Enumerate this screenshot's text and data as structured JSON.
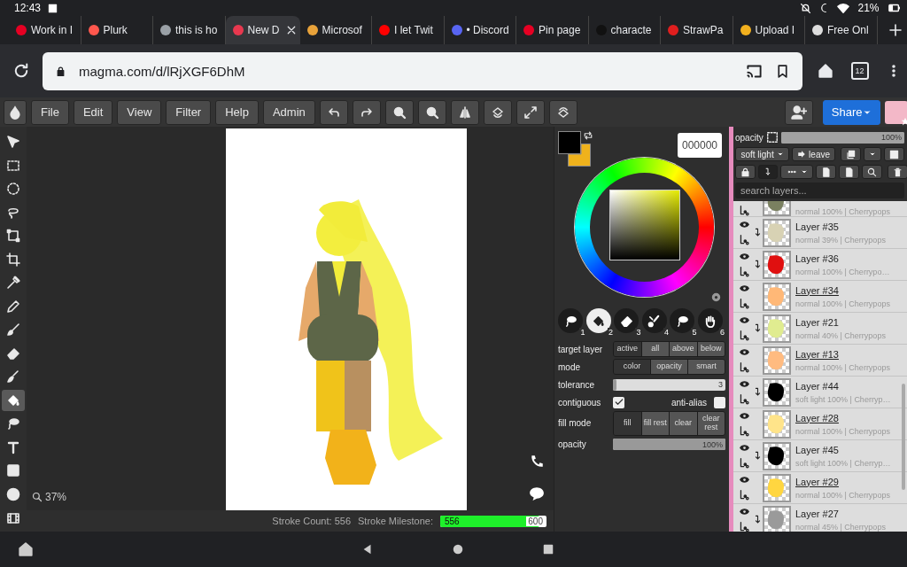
{
  "status_bar": {
    "time": "12:43",
    "battery": "21%"
  },
  "browser_tabs": [
    {
      "title": "Work in I",
      "color": "#e60023",
      "selected": false
    },
    {
      "title": "Plurk",
      "color": "#ff574d",
      "selected": false
    },
    {
      "title": "this is ho",
      "color": "#9aa0a6",
      "selected": false
    },
    {
      "title": "New D",
      "color": "#e8384f",
      "selected": true
    },
    {
      "title": "Microsof",
      "color": "#e8a23a",
      "selected": false
    },
    {
      "title": "I let Twit",
      "color": "#ff0000",
      "selected": false
    },
    {
      "title": "• Discord",
      "color": "#5865f2",
      "selected": false
    },
    {
      "title": "Pin page",
      "color": "#e60023",
      "selected": false
    },
    {
      "title": "characte",
      "color": "#111111",
      "selected": false
    },
    {
      "title": "StrawPa",
      "color": "#e01e1e",
      "selected": false
    },
    {
      "title": "Upload I",
      "color": "#f2b01e",
      "selected": false
    },
    {
      "title": "Free Onl",
      "color": "#dddddd",
      "selected": false
    }
  ],
  "address_bar": {
    "url": "magma.com/d/lRjXGF6DhM",
    "tab_count": "12"
  },
  "toolbar": {
    "menus": [
      "File",
      "Edit",
      "View",
      "Filter",
      "Help",
      "Admin"
    ],
    "share": "Share"
  },
  "tools": [
    {
      "kind": "move",
      "selected": false
    },
    {
      "kind": "rect-select",
      "selected": false
    },
    {
      "kind": "ellipse-select",
      "selected": false
    },
    {
      "kind": "lasso",
      "selected": false
    },
    {
      "kind": "transform",
      "selected": false
    },
    {
      "kind": "crop",
      "selected": false
    },
    {
      "kind": "eyedropper",
      "selected": false
    },
    {
      "kind": "pencil",
      "selected": false
    },
    {
      "kind": "brush",
      "selected": false
    },
    {
      "kind": "eraser",
      "selected": false
    },
    {
      "kind": "smudge",
      "selected": false
    },
    {
      "kind": "bucket",
      "selected": true
    },
    {
      "kind": "lasso-fill",
      "selected": false
    },
    {
      "kind": "text",
      "selected": false
    },
    {
      "kind": "rectangle",
      "selected": false
    },
    {
      "kind": "ellipse",
      "selected": false
    }
  ],
  "canvas": {
    "zoom": "37%"
  },
  "stroke_bar": {
    "count": "Stroke Count: 556",
    "milestone": "Stroke Milestone:",
    "progress": "556",
    "goal": "600",
    "level": 0.93
  },
  "swatches": [
    {
      "color": "#000000"
    },
    {
      "color": "#efb21c"
    }
  ],
  "hex": "000000",
  "fill_tools": [
    {
      "kind": "lasso-fill",
      "number": "1",
      "selected": false
    },
    {
      "kind": "bucket",
      "number": "2",
      "selected": true
    },
    {
      "kind": "eraser",
      "number": "3",
      "selected": false
    },
    {
      "kind": "brushes",
      "number": "4",
      "selected": false
    },
    {
      "kind": "lasso-fill",
      "number": "5",
      "selected": false
    },
    {
      "kind": "hand",
      "number": "6",
      "selected": false
    }
  ],
  "options": [
    {
      "kind": "segmented",
      "label": "target layer",
      "choices": [
        {
          "label": "active",
          "selected": true
        },
        {
          "label": "all",
          "selected": false
        },
        {
          "label": "above",
          "selected": false
        },
        {
          "label": "below",
          "selected": false
        }
      ]
    },
    {
      "kind": "segmented",
      "label": "mode",
      "choices": [
        {
          "label": "color",
          "selected": true
        },
        {
          "label": "opacity",
          "selected": false
        },
        {
          "label": "smart",
          "selected": false
        }
      ]
    },
    {
      "kind": "slider",
      "label": "tolerance",
      "value": "3",
      "level": 0.03
    },
    {
      "kind": "checks",
      "label": "contiguous",
      "checked": true,
      "second_label": "anti-alias",
      "second_checked": false
    },
    {
      "kind": "segmented",
      "label": "fill mode",
      "choices": [
        {
          "label": "fill",
          "selected": true
        },
        {
          "label": "fill rest",
          "selected": false
        },
        {
          "label": "clear",
          "selected": false
        },
        {
          "label": "clear rest",
          "selected": false
        }
      ]
    },
    {
      "kind": "slider",
      "label": "opacity",
      "value": "100%",
      "level": 1
    }
  ],
  "layers_panel": {
    "opacity_label": "opacity",
    "opacity": "100%",
    "level": 1,
    "blend": "soft light",
    "leave": "leave",
    "search_placeholder": "search layers..."
  },
  "layers": [
    {
      "meta": "normal 100% | Cherrypops",
      "clipped": false,
      "color": "#7a8060"
    },
    {
      "name": "Layer #35",
      "meta": "normal 39% | Cherrypops",
      "clipped": true,
      "color": "#d8d2b4"
    },
    {
      "name": "Layer #36",
      "meta": "normal 100% | Cherrypo…",
      "clipped": true,
      "color": "#e01010"
    },
    {
      "name": "Layer #34",
      "meta": "normal 100% | Cherrypops",
      "clipped": false,
      "color": "#ffb877"
    },
    {
      "name": "Layer #21",
      "meta": "normal 40% | Cherrypops",
      "clipped": true,
      "color": "#e0ec90"
    },
    {
      "name": "Layer #13",
      "meta": "normal 100% | Cherrypops",
      "clipped": false,
      "color": "#ffbb80"
    },
    {
      "name": "Layer #44",
      "meta": "soft light 100% | Cherryp…",
      "clipped": true,
      "color": "#000000"
    },
    {
      "name": "Layer #28",
      "meta": "normal 100% | Cherrypops",
      "clipped": false,
      "color": "#ffe48a"
    },
    {
      "name": "Layer #45",
      "meta": "soft light 100% | Cherryp…",
      "clipped": true,
      "color": "#000000"
    },
    {
      "name": "Layer #29",
      "meta": "normal 100% | Cherrypops",
      "clipped": false,
      "color": "#ffd640"
    },
    {
      "name": "Layer #27",
      "meta": "normal 45% | Cherrypops",
      "clipped": true,
      "color": "#9a9a9a"
    }
  ]
}
